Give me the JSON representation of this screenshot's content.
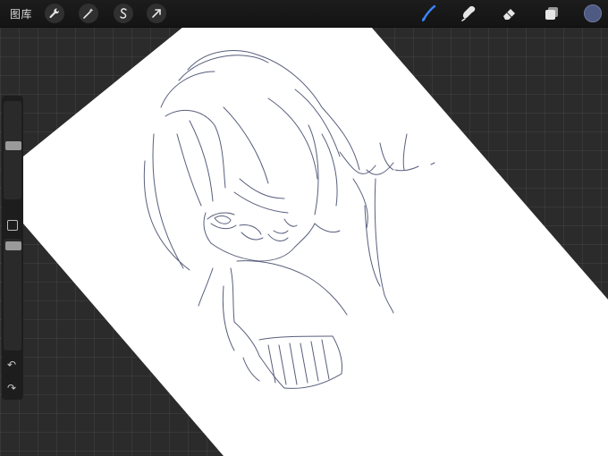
{
  "topbar": {
    "gallery_label": "图库",
    "left_tools": [
      {
        "name": "actions-wrench-icon"
      },
      {
        "name": "adjustments-wand-icon"
      },
      {
        "name": "selection-icon"
      },
      {
        "name": "transform-arrow-icon"
      }
    ],
    "right_tools": [
      {
        "name": "brush-icon",
        "active": true
      },
      {
        "name": "smudge-icon"
      },
      {
        "name": "eraser-icon"
      },
      {
        "name": "layers-icon"
      }
    ],
    "current_color": "#4e5a82"
  },
  "sidebar": {
    "brush_size_level": 0.55,
    "opacity_level": 0.97
  },
  "canvas": {
    "paper_color": "#ffffff",
    "sketch_stroke_color": "#3c4466"
  },
  "theme": {
    "accent": "#3b86ff",
    "toolbar_bg": "#1a1a1a"
  }
}
